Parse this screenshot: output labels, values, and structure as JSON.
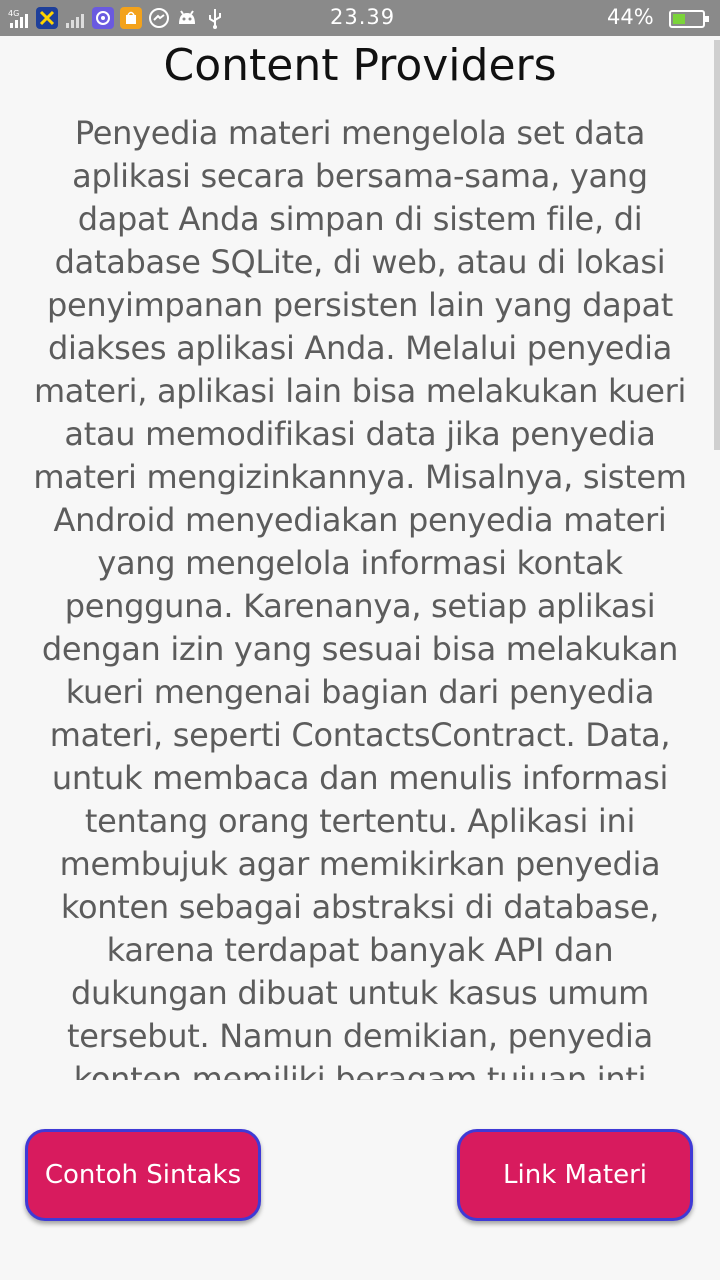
{
  "status_bar": {
    "network": "4G",
    "time": "23.39",
    "battery_percent": "44%",
    "battery_level": 0.44,
    "icons": [
      "signal-4g-icon",
      "xl-carrier-icon",
      "signal-icon",
      "browser-icon",
      "shop-icon",
      "messenger-icon",
      "android-icon",
      "usb-icon"
    ]
  },
  "page": {
    "title": "Content Providers",
    "body": "Penyedia materi mengelola set data aplikasi secara bersama-sama, yang dapat Anda simpan di sistem file, di database SQLite, di web, atau di lokasi penyimpanan persisten lain yang dapat diakses aplikasi Anda. Melalui penyedia materi, aplikasi lain bisa melakukan kueri atau memodifikasi data jika penyedia materi mengizinkannya. Misalnya, sistem Android menyediakan penyedia materi yang mengelola informasi kontak pengguna. Karenanya, setiap aplikasi dengan izin yang sesuai bisa melakukan kueri mengenai bagian dari penyedia materi, seperti ContactsContract. Data, untuk membaca dan menulis informasi tentang orang tertentu. Aplikasi ini membujuk agar memikirkan penyedia konten sebagai abstraksi di database, karena terdapat banyak API dan dukungan dibuat untuk kasus umum tersebut. Namun demikian, penyedia konten memiliki beragam tujuan inti"
  },
  "buttons": {
    "left_label": "Contoh Sintaks",
    "right_label": "Link Materi"
  },
  "colors": {
    "button_fill": "#d81b5e",
    "button_border": "#3f3ad6",
    "status_bar": "#8a8a8a",
    "battery_fill": "#7bd43a"
  }
}
